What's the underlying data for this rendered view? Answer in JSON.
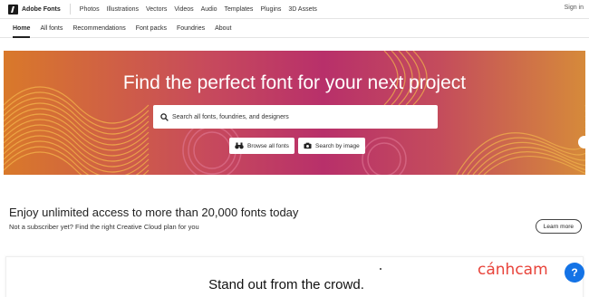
{
  "brand": {
    "name": "Adobe Fonts"
  },
  "topnav": [
    "Photos",
    "Illustrations",
    "Vectors",
    "Videos",
    "Audio",
    "Templates",
    "Plugins",
    "3D Assets"
  ],
  "signin": "Sign in",
  "subnav": [
    "Home",
    "All fonts",
    "Recommendations",
    "Font packs",
    "Foundries",
    "About"
  ],
  "hero": {
    "title": "Find the perfect font for your next project",
    "search_placeholder": "Search all fonts, foundries, and designers",
    "browse_label": "Browse all fonts",
    "image_search_label": "Search by image"
  },
  "promo": {
    "title": "Enjoy unlimited access to more than 20,000 fonts today",
    "subtitle": "Not a subscriber yet? Find the right Creative Cloud plan for you",
    "learn_more": "Learn more"
  },
  "card": {
    "title": "Stand out from the crowd."
  },
  "watermark": "cánhcam",
  "help": "?",
  "colors": {
    "accent": "#1473e6",
    "hero_pink": "#b8306a",
    "hero_orange": "#d9792a",
    "watermark": "#e8433a"
  },
  "icons": [
    "adobe-logo-icon",
    "search-icon",
    "binoculars-icon",
    "camera-icon",
    "help-icon"
  ]
}
